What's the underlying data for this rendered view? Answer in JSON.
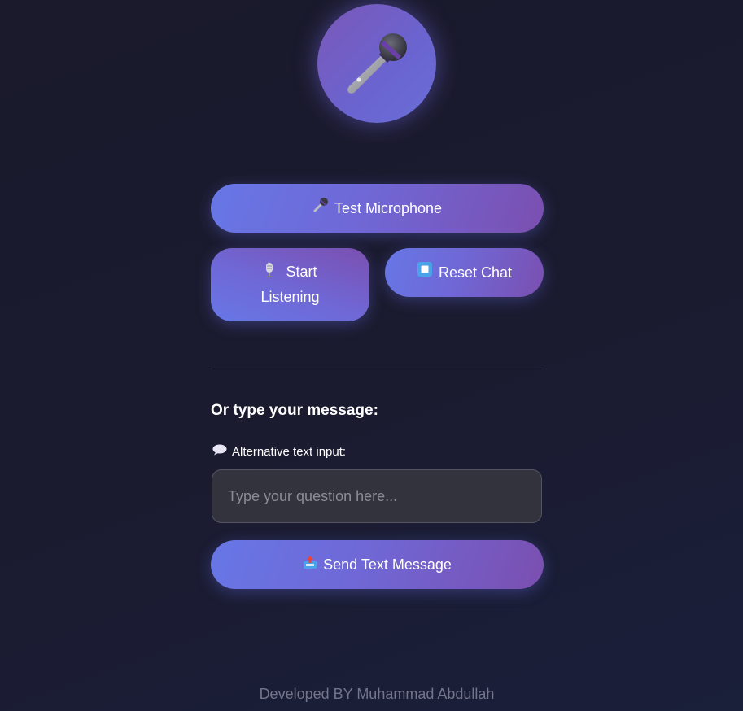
{
  "hero": {
    "icon": "microphone-icon"
  },
  "buttons": {
    "test_mic": {
      "icon": "microphone-icon",
      "label": "Test Microphone"
    },
    "start_listening": {
      "icon": "studio-microphone-icon",
      "label": "Start Listening"
    },
    "reset_chat": {
      "icon": "stop-icon",
      "label": "Reset Chat"
    },
    "send_text": {
      "icon": "outbox-tray-icon",
      "label": "Send Text Message"
    }
  },
  "text_section": {
    "heading": "Or type your message:",
    "input_label_icon": "speech-balloon-icon",
    "input_label": "Alternative text input:",
    "input_value": "",
    "input_placeholder": "Type your question here..."
  },
  "footer": {
    "credit": "Developed BY Muhammad Abdullah"
  },
  "colors": {
    "background": "#1b1b30",
    "accent_start": "#6777e6",
    "accent_end": "#7b4fb0",
    "input_bg": "#33333d",
    "footer_text": "#74748a"
  }
}
